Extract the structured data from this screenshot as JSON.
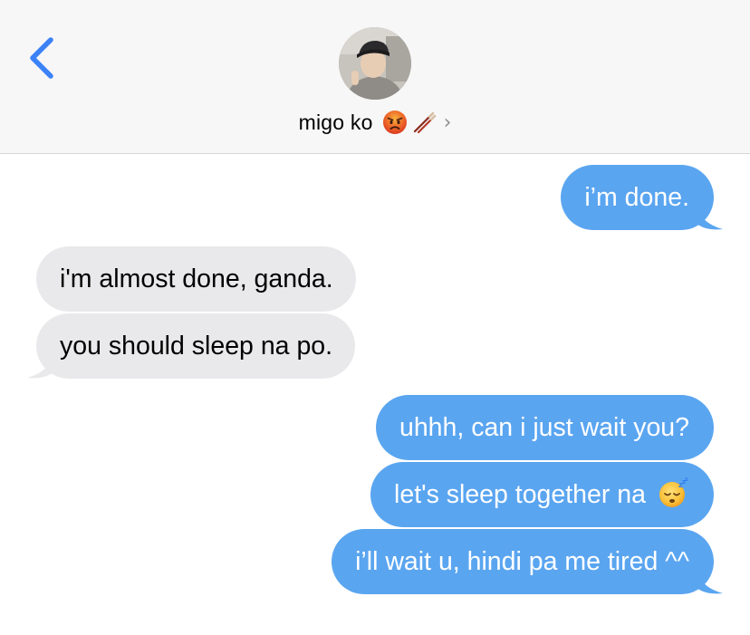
{
  "header": {
    "contact_name": "migo ko",
    "contact_emojis": [
      "angry-face-emoji",
      "chopsticks-emoji"
    ],
    "chevron": "›"
  },
  "colors": {
    "sent_bubble": "#5aa5f0",
    "received_bubble": "#e9e9eb",
    "accent": "#3b82f6",
    "header_bg": "#f7f7f7"
  },
  "messages": [
    {
      "from": "me",
      "text": "i’m done."
    },
    {
      "from": "them",
      "text": "i'm almost done, ganda."
    },
    {
      "from": "them",
      "text": "you should sleep na po."
    },
    {
      "from": "me",
      "text": "uhhh, can i just wait you?"
    },
    {
      "from": "me",
      "text": "let's sleep together na",
      "emoji": "sleeping-face-emoji"
    },
    {
      "from": "me",
      "text": "i’ll wait u, hindi pa me tired ^^"
    }
  ]
}
